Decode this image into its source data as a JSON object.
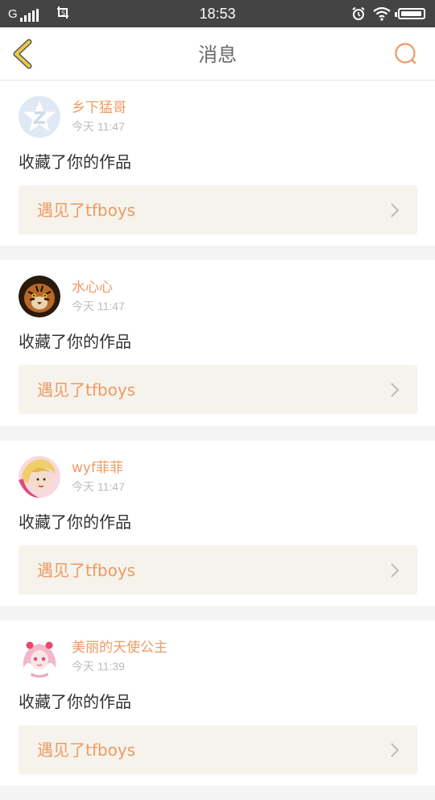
{
  "status_bar": {
    "carrier": "G",
    "time": "18:53",
    "battery_level": 0.95
  },
  "header": {
    "title": "消息"
  },
  "notifications": [
    {
      "username": "乡下猛哥",
      "time": "今天 11:47",
      "action": "收藏了你的作品",
      "work_title": "遇见了tfboys",
      "avatar": "default-avatar-icon"
    },
    {
      "username": "水心心",
      "time": "今天 11:47",
      "action": "收藏了你的作品",
      "work_title": "遇见了tfboys",
      "avatar": "tiger-avatar"
    },
    {
      "username": "wyf菲菲",
      "time": "今天 11:47",
      "action": "收藏了你的作品",
      "work_title": "遇见了tfboys",
      "avatar": "girl-avatar"
    },
    {
      "username": "美丽的天使公主",
      "time": "今天 11:39",
      "action": "收藏了你的作品",
      "work_title": "遇见了tfboys",
      "avatar": "anime-princess-avatar"
    }
  ],
  "colors": {
    "accent": "#ee9a62",
    "back_arrow": "#e7c94a",
    "status_bar": "#444444",
    "card_link_bg": "#f5f3ec"
  }
}
